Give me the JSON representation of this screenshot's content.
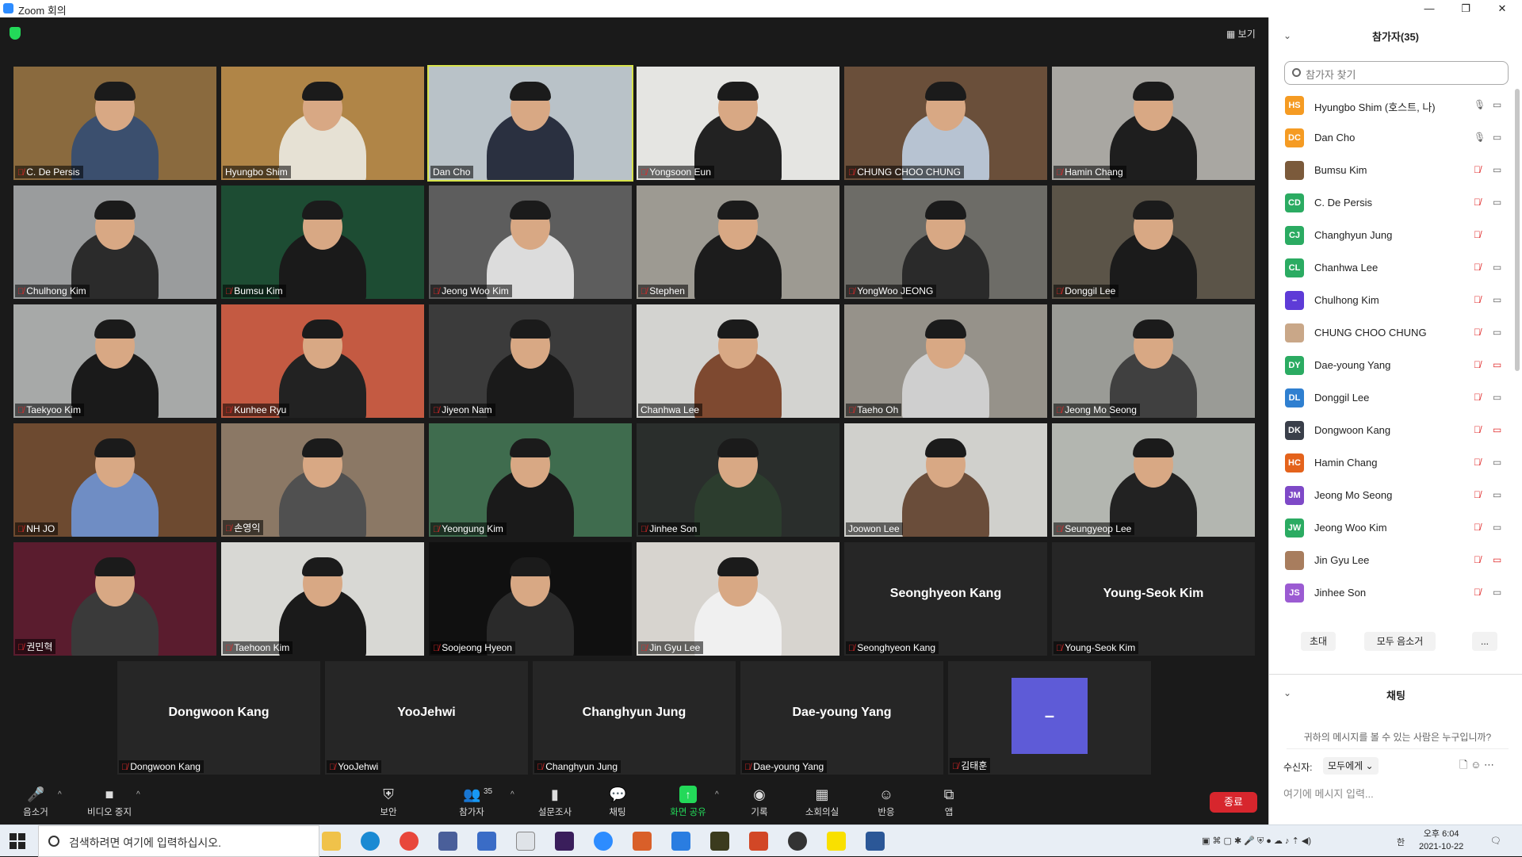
{
  "window": {
    "title": "Zoom 회의",
    "min": "—",
    "max": "❐",
    "close": "✕"
  },
  "view_button": "▦ 보기",
  "grid": [
    {
      "name": "C. De Persis",
      "muted": true,
      "bg": "#8a6a3e",
      "shirt": "#3b4f6e",
      "hl": false
    },
    {
      "name": "Hyungbo Shim",
      "muted": false,
      "bg": "#b08547",
      "shirt": "#e6e1d4",
      "hl": false
    },
    {
      "name": "Dan Cho",
      "muted": false,
      "bg": "#b9c2c8",
      "shirt": "#2a3040",
      "hl": true
    },
    {
      "name": "Yongsoon Eun",
      "muted": true,
      "bg": "#e5e5e2",
      "shirt": "#222",
      "hl": false
    },
    {
      "name": "CHUNG CHOO CHUNG",
      "muted": true,
      "bg": "#6a4f3a",
      "shirt": "#b7c3d2",
      "hl": false
    },
    {
      "name": "Hamin Chang",
      "muted": true,
      "bg": "#a9a7a2",
      "shirt": "#1e1e1e",
      "hl": false
    },
    {
      "name": "Chulhong Kim",
      "muted": true,
      "bg": "#9a9c9d",
      "shirt": "#2b2b2b",
      "hl": false
    },
    {
      "name": "Bumsu Kim",
      "muted": true,
      "bg": "#1d4c33",
      "shirt": "#1a1a1a",
      "hl": false
    },
    {
      "name": "Jeong Woo Kim",
      "muted": true,
      "bg": "#5d5d5d",
      "shirt": "#dcdcdc",
      "hl": false
    },
    {
      "name": "Stephen",
      "muted": true,
      "bg": "#9d9a92",
      "shirt": "#1c1c1c",
      "hl": false
    },
    {
      "name": "YongWoo JEONG",
      "muted": true,
      "bg": "#6d6c67",
      "shirt": "#2a2a2a",
      "hl": false
    },
    {
      "name": "Donggil Lee",
      "muted": true,
      "bg": "#5b5448",
      "shirt": "#1b1b1b",
      "hl": false
    },
    {
      "name": "Taekyoo Kim",
      "muted": true,
      "bg": "#a7a9a8",
      "shirt": "#1a1a1a",
      "hl": false
    },
    {
      "name": "Kunhee Ryu",
      "muted": true,
      "bg": "#c45a42",
      "shirt": "#222",
      "hl": false
    },
    {
      "name": "Jiyeon Nam",
      "muted": true,
      "bg": "#3b3b3b",
      "shirt": "#1a1a1a",
      "hl": false
    },
    {
      "name": "Chanhwa Lee",
      "muted": false,
      "bg": "#d3d3d0",
      "shirt": "#7e4930",
      "hl": false
    },
    {
      "name": "Taeho Oh",
      "muted": true,
      "bg": "#96928a",
      "shirt": "#cfcfcf",
      "hl": false
    },
    {
      "name": "Jeong Mo Seong",
      "muted": true,
      "bg": "#9a9b96",
      "shirt": "#404040",
      "hl": false
    },
    {
      "name": "NH JO",
      "muted": true,
      "bg": "#6d4a30",
      "shirt": "#6f8dc4",
      "hl": false
    },
    {
      "name": "손영익",
      "muted": true,
      "bg": "#8b7865",
      "shirt": "#505050",
      "hl": false
    },
    {
      "name": "Yeongung Kim",
      "muted": true,
      "bg": "#3f6c4e",
      "shirt": "#1a1a1a",
      "hl": false
    },
    {
      "name": "Jinhee Son",
      "muted": true,
      "bg": "#2a2e2c",
      "shirt": "#2c3d2e",
      "hl": false
    },
    {
      "name": "Joowon Lee",
      "muted": false,
      "bg": "#d0d0cc",
      "shirt": "#6a4d3a",
      "hl": false
    },
    {
      "name": "Seungyeop Lee",
      "muted": true,
      "bg": "#b3b6b0",
      "shirt": "#222",
      "hl": false
    },
    {
      "name": "권민혁",
      "muted": true,
      "bg": "#5a1c2e",
      "shirt": "#3a3a3a",
      "hl": false
    },
    {
      "name": "Taehoon Kim",
      "muted": true,
      "bg": "#d8d8d4",
      "shirt": "#1a1a1a",
      "hl": false
    },
    {
      "name": "Soojeong Hyeon",
      "muted": true,
      "bg": "#101010",
      "shirt": "#2a2a2a",
      "hl": false
    },
    {
      "name": "Jin Gyu Lee",
      "muted": true,
      "bg": "#d7d4cf",
      "shirt": "#f0f0f0",
      "hl": false
    }
  ],
  "name_tiles_row5": [
    {
      "big": "Seonghyeon Kang",
      "name": "Seonghyeon Kang"
    },
    {
      "big": "Young-Seok Kim",
      "name": "Young-Seok Kim"
    }
  ],
  "name_tiles_row6": [
    {
      "big": "Dongwoon Kang",
      "name": "Dongwoon Kang"
    },
    {
      "big": "YooJehwi",
      "name": "YooJehwi"
    },
    {
      "big": "Changhyun Jung",
      "name": "Changhyun Jung"
    },
    {
      "big": "Dae-young Yang",
      "name": "Dae-young Yang"
    }
  ],
  "avatar_tile": {
    "name": "김태훈",
    "initial": "–",
    "color": "#5e5bd7"
  },
  "toolbar": {
    "mute": "음소거",
    "video": "비디오 중지",
    "security": "보안",
    "participants": "참가자",
    "participants_count": "35",
    "polls": "설문조사",
    "chat": "채팅",
    "share": "화면 공유",
    "record": "기록",
    "breakout": "소회의실",
    "reactions": "반응",
    "apps": "앱",
    "end": "종료"
  },
  "sidebar": {
    "title": "참가자(35)",
    "search_placeholder": "참가자 찾기",
    "participants": [
      {
        "initials": "HS",
        "color": "#f59b23",
        "name": "Hyungbo Shim (호스트, 나)",
        "mic": "on",
        "cam": "on"
      },
      {
        "initials": "DC",
        "color": "#f59b23",
        "name": "Dan Cho",
        "mic": "on",
        "cam": "on"
      },
      {
        "initials": "",
        "color": "#7b5a3b",
        "name": "Bumsu Kim",
        "mic": "off",
        "cam": "on"
      },
      {
        "initials": "CD",
        "color": "#2bab62",
        "name": "C. De Persis",
        "mic": "off",
        "cam": "on"
      },
      {
        "initials": "CJ",
        "color": "#2bab62",
        "name": "Changhyun Jung",
        "mic": "off",
        "cam": "none"
      },
      {
        "initials": "CL",
        "color": "#2bab62",
        "name": "Chanhwa Lee",
        "mic": "off",
        "cam": "on"
      },
      {
        "initials": "–",
        "color": "#5e3bd7",
        "name": "Chulhong Kim",
        "mic": "off",
        "cam": "on"
      },
      {
        "initials": "",
        "color": "#c9a788",
        "name": "CHUNG CHOO CHUNG",
        "mic": "off",
        "cam": "on"
      },
      {
        "initials": "DY",
        "color": "#2bab62",
        "name": "Dae-young Yang",
        "mic": "off",
        "cam": "off"
      },
      {
        "initials": "DL",
        "color": "#2f7fd0",
        "name": "Donggil Lee",
        "mic": "off",
        "cam": "on"
      },
      {
        "initials": "DK",
        "color": "#3a3f4a",
        "name": "Dongwoon Kang",
        "mic": "off",
        "cam": "off"
      },
      {
        "initials": "HC",
        "color": "#e4631c",
        "name": "Hamin Chang",
        "mic": "off",
        "cam": "on"
      },
      {
        "initials": "JM",
        "color": "#7e49c7",
        "name": "Jeong Mo Seong",
        "mic": "off",
        "cam": "on"
      },
      {
        "initials": "JW",
        "color": "#2bab62",
        "name": "Jeong Woo Kim",
        "mic": "off",
        "cam": "on"
      },
      {
        "initials": "",
        "color": "#a87d5e",
        "name": "Jin Gyu Lee",
        "mic": "off",
        "cam": "off"
      },
      {
        "initials": "JS",
        "color": "#9b5bd2",
        "name": "Jinhee Son",
        "mic": "off",
        "cam": "on"
      }
    ],
    "invite": "초대",
    "mute_all": "모두 음소거",
    "more": "...",
    "chat_title": "채팅",
    "chat_hint": "귀하의 메시지를 볼 수 있는 사람은 누구입니까?",
    "recipient_label": "수신자:",
    "recipient": "모두에게 ⌄",
    "chat_placeholder": "여기에 메시지 입력..."
  },
  "taskbar": {
    "search_placeholder": "검색하려면 여기에 입력하십시오.",
    "time": "오후 6:04",
    "date": "2021-10-22",
    "ime": "한"
  }
}
